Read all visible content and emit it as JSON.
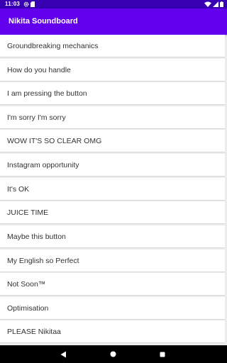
{
  "status_bar": {
    "time": "11:03",
    "icons": [
      "settings-icon",
      "sd-card-icon",
      "wifi-icon",
      "signal-icon",
      "battery-icon"
    ]
  },
  "app_bar": {
    "title": "Nikita Soundboard"
  },
  "sounds": [
    {
      "label": "Groundbreaking mechanics"
    },
    {
      "label": "How do you handle"
    },
    {
      "label": "I am pressing the button"
    },
    {
      "label": "I'm sorry I'm sorry"
    },
    {
      "label": "WOW IT'S SO CLEAR OMG"
    },
    {
      "label": "Instagram opportunity"
    },
    {
      "label": "It's OK"
    },
    {
      "label": "JUICE TIME"
    },
    {
      "label": "Maybe this button"
    },
    {
      "label": "My English so Perfect"
    },
    {
      "label": "Not Soon™"
    },
    {
      "label": "Optimisation"
    },
    {
      "label": "PLEASE Nikitaa"
    }
  ],
  "nav_bar": {
    "buttons": [
      "back-icon",
      "home-icon",
      "recents-icon"
    ]
  },
  "colors": {
    "status_bar": "#3700b3",
    "app_bar": "#6200ee",
    "list_background": "#ececec",
    "item_background": "#ffffff",
    "item_text": "#333333",
    "nav_bar": "#000000"
  }
}
